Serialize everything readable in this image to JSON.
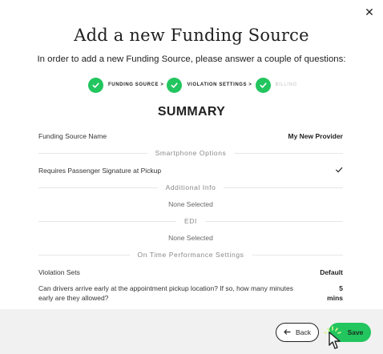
{
  "modal": {
    "title": "Add a new Funding Source",
    "subtitle": "In order to add a new Funding Source, please answer a couple of questions:",
    "close_icon": "close-icon"
  },
  "stepper": {
    "steps": [
      {
        "label": "FUNDING SOURCE >",
        "completed": true
      },
      {
        "label": "VIOLATION SETTINGS >",
        "completed": true
      },
      {
        "label": "BILLING",
        "completed": true
      }
    ]
  },
  "summary": {
    "title": "SUMMARY",
    "funding_source_name_label": "Funding Source Name",
    "funding_source_name_value": "My New Provider",
    "smartphone_header": "Smartphone Options",
    "signature_label": "Requires Passenger Signature at Pickup",
    "signature_icon": "checkmark-icon",
    "additional_info_header": "Additional Info",
    "additional_info_value": "None Selected",
    "edi_header": "EDI",
    "edi_value": "None Selected",
    "otp_header": "On Time Performance Settings",
    "violation_sets_label": "Violation Sets",
    "violation_sets_value": "Default",
    "early_arrival_label": "Can drivers arrive early at the appointment pickup location? If so, how many minutes early are they allowed?",
    "early_arrival_value_line1": "5",
    "early_arrival_value_line2": "mins"
  },
  "footer": {
    "back_label": "Back",
    "save_label": "Save"
  },
  "colors": {
    "accent": "#22c55e",
    "footer_bg": "#f1f1f1",
    "muted_step": "#c4c4c4"
  }
}
